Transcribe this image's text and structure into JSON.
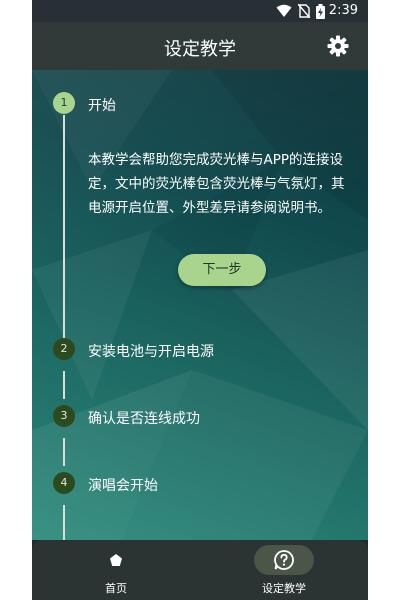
{
  "status_bar": {
    "time": "2:39",
    "icons": [
      "wifi-icon",
      "no-sim-icon",
      "battery-charging-icon"
    ]
  },
  "header": {
    "title": "设定教学",
    "settings_icon": "gear-icon"
  },
  "colors": {
    "accent": "#a8d48e",
    "inactive_step": "#2d4a1f",
    "app_bar": "#303a39"
  },
  "steps": [
    {
      "number": "1",
      "label": "开始",
      "state": "active"
    },
    {
      "number": "2",
      "label": "安装电池与开启电源",
      "state": "inactive"
    },
    {
      "number": "3",
      "label": "确认是否连线成功",
      "state": "inactive"
    },
    {
      "number": "4",
      "label": "演唱会开始",
      "state": "inactive"
    }
  ],
  "step1": {
    "description": "本教学会帮助您完成荧光棒与APP的连接设定，文中的荧光棒包含荧光棒与气氛灯，其电源开启位置、外型差异请参阅说明书。",
    "next_button": "下一步"
  },
  "bottom_nav": {
    "items": [
      {
        "label": "首页",
        "icon": "home-pentagon-icon",
        "selected": false
      },
      {
        "label": "设定教学",
        "icon": "help-circle-icon",
        "selected": true
      }
    ]
  }
}
